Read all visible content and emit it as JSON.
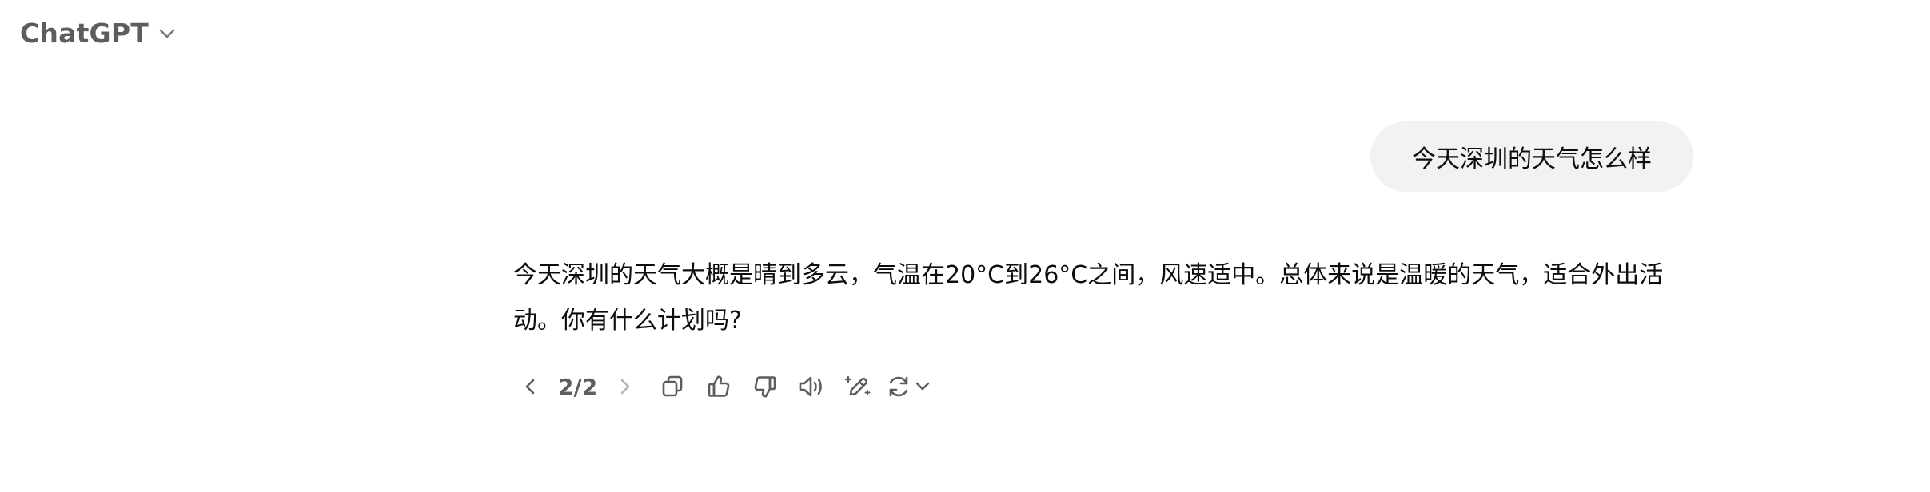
{
  "header": {
    "model_name": "ChatGPT",
    "dropdown_icon": "chevron-down-icon"
  },
  "conversation": {
    "user_message": "今天深圳的天气怎么样",
    "assistant_message": "今天深圳的天气大概是晴到多云，气温在20°C到26°C之间，风速适中。总体来说是温暖的天气，适合外出活动。你有什么计划吗?"
  },
  "actions": {
    "pager": "2/2",
    "icons": [
      "chevron-left-icon",
      "chevron-right-icon",
      "copy-icon",
      "thumbs-up-icon",
      "thumbs-down-icon",
      "speaker-icon",
      "edit-pen-icon",
      "regenerate-icon",
      "chevron-down-icon"
    ]
  },
  "colors": {
    "title_gray": "#5d5d5d",
    "bubble_bg": "#f2f2f2",
    "text": "#0d0d0d",
    "icon": "#5d5d5d",
    "icon_disabled": "#b4b4b4"
  }
}
